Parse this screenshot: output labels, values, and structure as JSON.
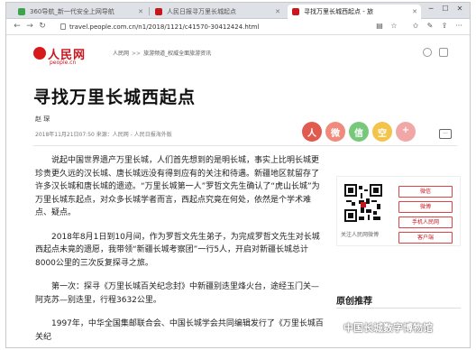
{
  "browser": {
    "tabs": [
      {
        "label": "360导航_新一代安全上网导航",
        "favicon_color": "#3da44c"
      },
      {
        "label": "人民日报寻万里长城起点 ",
        "favicon_color": "#c8161d"
      },
      {
        "label": "寻找万里长城西起点 - 旅",
        "favicon_color": "#c8161d"
      }
    ],
    "url": "travel.people.com.cn/n1/2018/1121/c41570-30412424.html"
  },
  "header": {
    "logo_cn": "人民网",
    "logo_en": "people.cn",
    "breadcrumb": [
      "人民网",
      "旅游频道_权威全面旅游资讯"
    ]
  },
  "article": {
    "title": "寻找万里长城西起点",
    "author": "赵 琛",
    "meta": "2018年11月21日07:50  来源：人民网 - 人民日报海外版",
    "paragraphs": [
      "说起中国世界遗产万里长城，人们首先想到的是明长城，事实上比明长城更珍贵更久远的汉长城、唐长城远没有得到应有的关注和待遇。新疆地区就留存了许多汉长城和唐长城的遗迹。“万里长城第一人”罗哲文先生确认了“虎山长城”为万里长城东起点，对众多长城学者而言，西起点究竟在何处，依然是个学术难点、疑点。",
      "2018年8月1日到10月间，作为罗哲文先生弟子，为完成罗哲文先生对长城西起点未竟的遗愿，我带领“新疆长城考察团”一行5人，开启对新疆长城总计8000公里的三次反复探寻之旅。",
      "第一次：探寻《万里长城百关纪念封》中新疆别迭里烽火台，途经玉门关—阿克苏—别迭里，行程3632公里。",
      "1997年，中华全国集邮联合会、中国长城学会共同编辑发行了《万里长城百关纪"
    ]
  },
  "share": [
    {
      "name": "people",
      "glyph": "人",
      "color": "#e05a4f"
    },
    {
      "name": "weibo",
      "glyph": "微",
      "color": "#f08a7c"
    },
    {
      "name": "wechat",
      "glyph": "信",
      "color": "#77c87a"
    },
    {
      "name": "qzone",
      "glyph": "空",
      "color": "#f3c34b"
    },
    {
      "name": "more",
      "glyph": "+",
      "color": "#f2a7a7"
    }
  ],
  "comment_label": "···",
  "sidebar": {
    "qr_label": "关注人民网微博",
    "buttons": [
      "微信",
      "微博",
      "手机人民网",
      "客户端"
    ]
  },
  "recommend": {
    "heading": "原创推荐"
  },
  "watermark": "中国长城数字博物馆",
  "colors": {
    "accent": "#c8161d"
  }
}
